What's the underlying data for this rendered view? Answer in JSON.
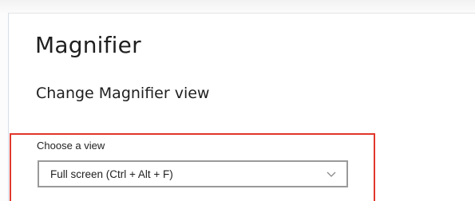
{
  "page": {
    "title": "Magnifier"
  },
  "section": {
    "title": "Change Magnifier view"
  },
  "view_setting": {
    "label": "Choose a view",
    "selected_value": "Full screen (Ctrl + Alt + F)"
  },
  "colors": {
    "highlight": "#e2362b",
    "select_border": "#9a9a9a",
    "text": "#1f1f1f"
  },
  "icons": {
    "dropdown": "chevron-down-icon"
  }
}
